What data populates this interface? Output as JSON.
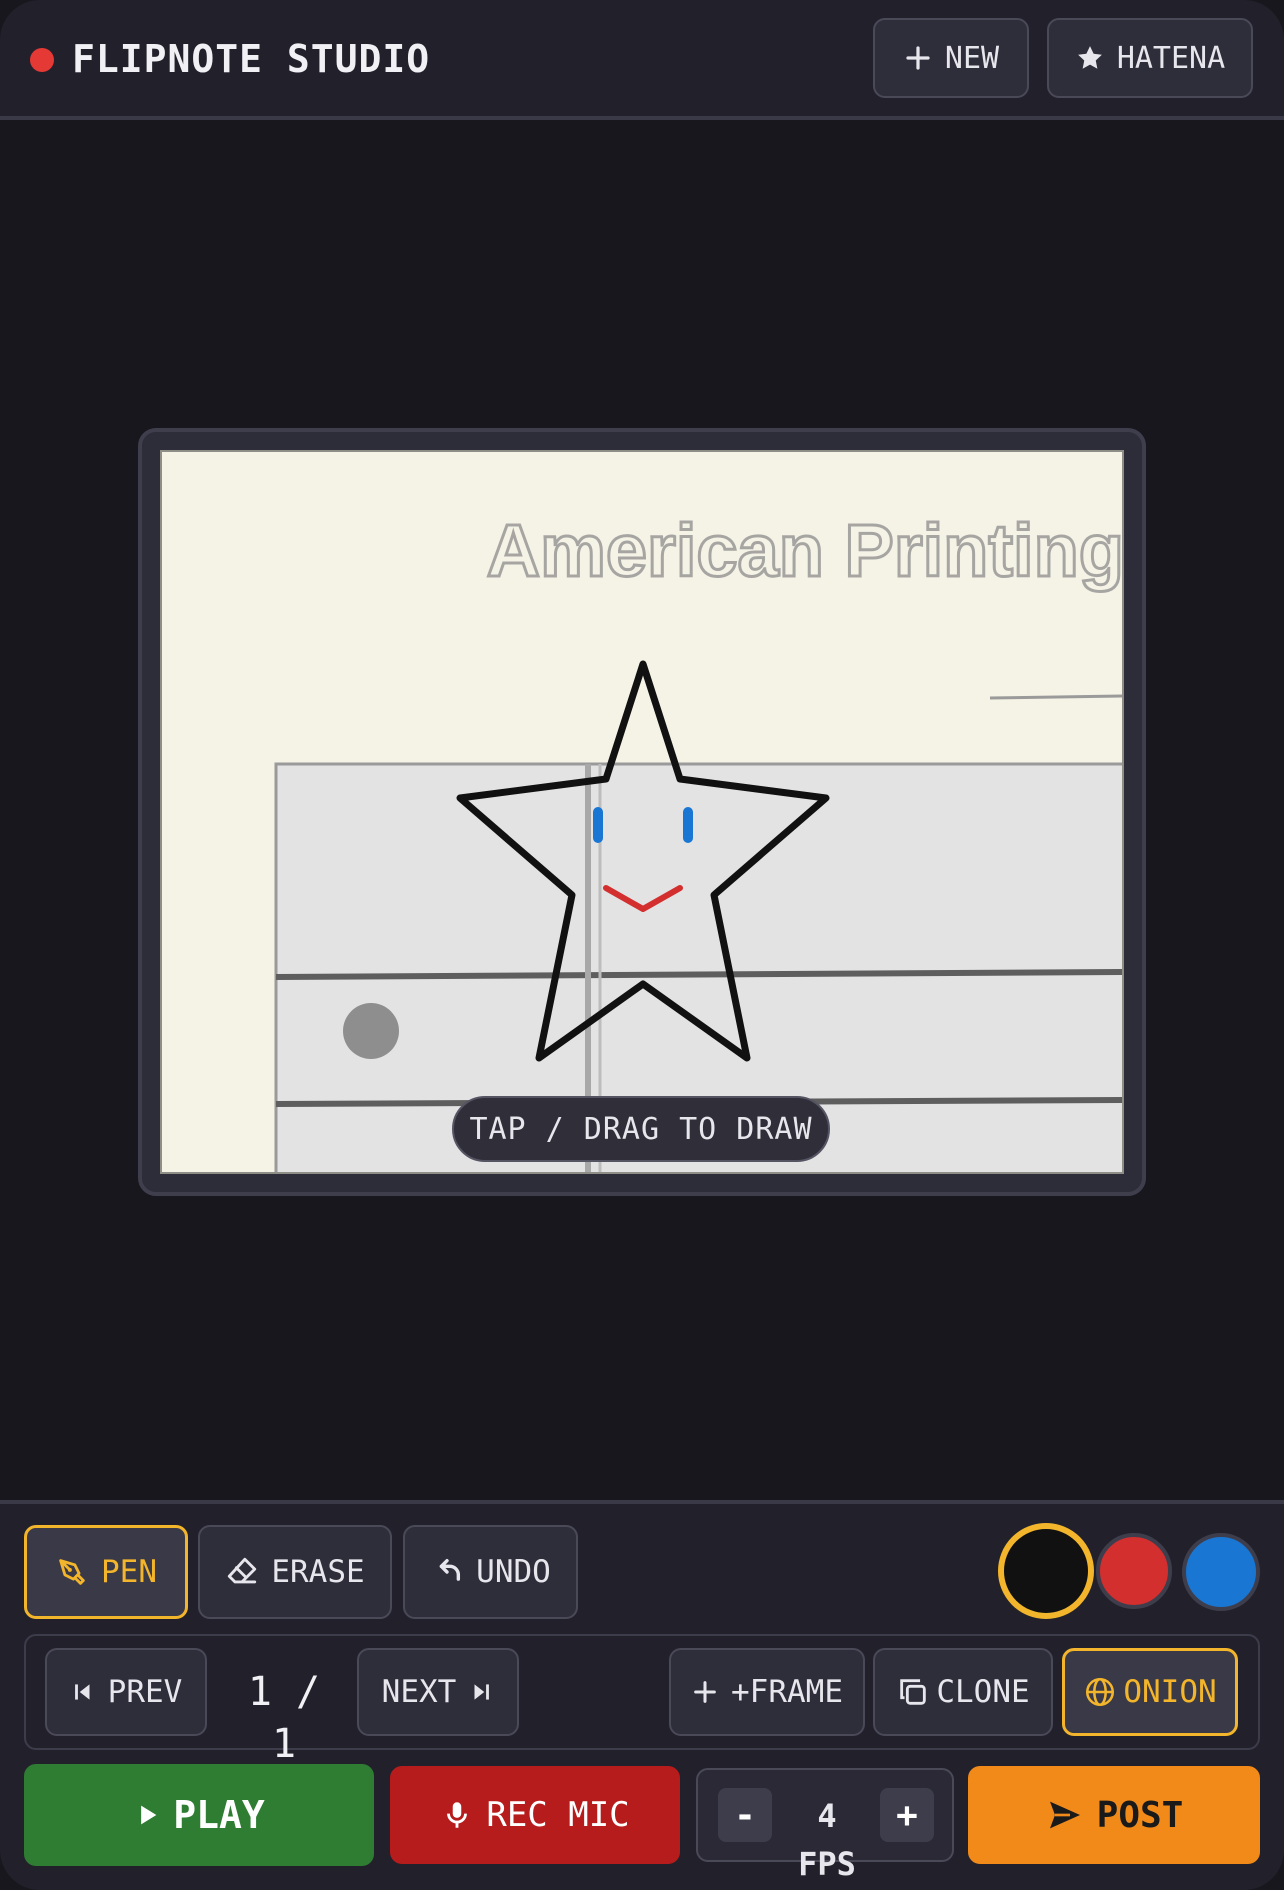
{
  "header": {
    "title": "FLIPNOTE STUDIO",
    "new_label": "NEW",
    "hatena_label": "HATENA"
  },
  "canvas": {
    "background_text": "American Printing",
    "hint": "TAP / DRAG TO DRAW"
  },
  "tools": {
    "pen_label": "PEN",
    "erase_label": "ERASE",
    "undo_label": "UNDO",
    "active_tool": "PEN",
    "colors": [
      "#111111",
      "#d32f2f",
      "#1976d2"
    ],
    "selected_color": "#111111"
  },
  "frames": {
    "prev_label": "PREV",
    "current": "1",
    "separator": "/",
    "total": "1",
    "counter": "1 / 1",
    "next_label": "NEXT",
    "add_frame_label": "+FRAME",
    "clone_label": "CLONE",
    "onion_label": "ONION",
    "onion_active": true
  },
  "playback": {
    "play_label": "PLAY",
    "rec_label": "REC MIC",
    "fps_minus": "-",
    "fps_value": "4 FPS",
    "fps_plus": "+",
    "post_label": "POST"
  },
  "colors": {
    "accent": "#f2b52b",
    "play": "#2e7d32",
    "rec": "#b71c1c",
    "post": "#f28a1a",
    "record_dot": "#e53935"
  }
}
